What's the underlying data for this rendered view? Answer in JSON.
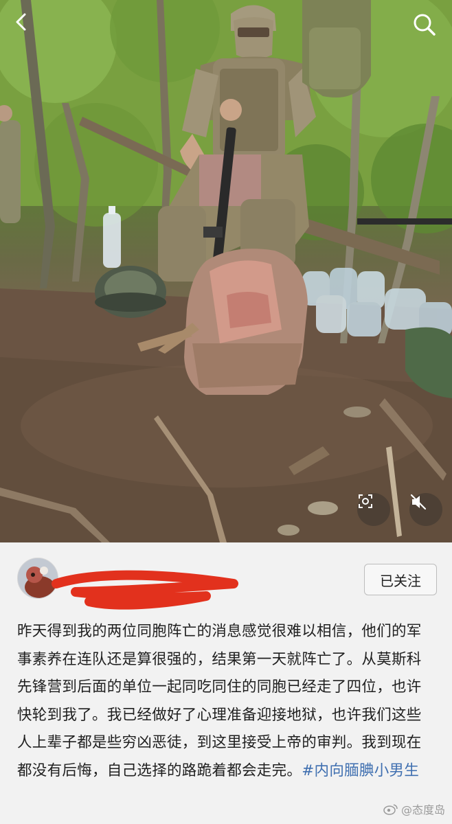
{
  "post": {
    "author_name": "",
    "follow_label": "已关注",
    "text": "昨天得到我的两位同胞阵亡的消息感觉很难以相信，他们的军事素养在连队还是算很强的，结果第一天就阵亡了。从莫斯科先锋营到后面的单位一起同吃同住的同胞已经走了四位，也许快轮到我了。我已经做好了心理准备迎接地狱，也许我们这些人上辈子都是些穷凶恶徒，到这里接受上帝的审判。我到现在都没有后悔，自己选择的路跪着都会走完。",
    "hashtag": "#内向腼腆小男生"
  },
  "watermark": {
    "text": "@态度岛"
  },
  "icons": {
    "back": "back-arrow-icon",
    "search": "search-icon",
    "scan": "scan-icon",
    "mute": "mute-icon"
  },
  "colors": {
    "hashtag": "#3f6fb0",
    "redaction": "#e2311d",
    "card_background": "#f2f2f2"
  }
}
